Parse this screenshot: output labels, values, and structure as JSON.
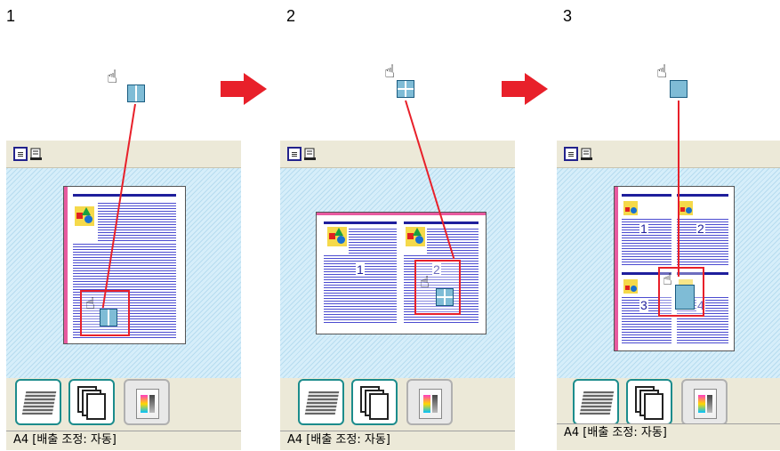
{
  "steps": [
    {
      "number": "1",
      "status": "A4 [배출 조정: 자동]",
      "layout": "two-up"
    },
    {
      "number": "2",
      "status": "A4 [배출 조정: 자동]",
      "layout": "four-up",
      "page_labels": [
        "1",
        "2"
      ]
    },
    {
      "number": "3",
      "status": "A4 [배출 조정: 자동]",
      "layout": "one-up",
      "page_labels": [
        "1",
        "2",
        "3",
        "4"
      ]
    }
  ],
  "colors": {
    "accent": "#e8202a",
    "binding": "#e85aa0",
    "text_lines": "#2b2bc8",
    "toolbar": "#ece9d8",
    "preview_bg": "#d6eefa"
  },
  "icons": [
    "hand-cursor-icon",
    "page-layout-icon",
    "printer-icon",
    "copies-icon",
    "color-settings-icon",
    "arrow-right-icon"
  ]
}
